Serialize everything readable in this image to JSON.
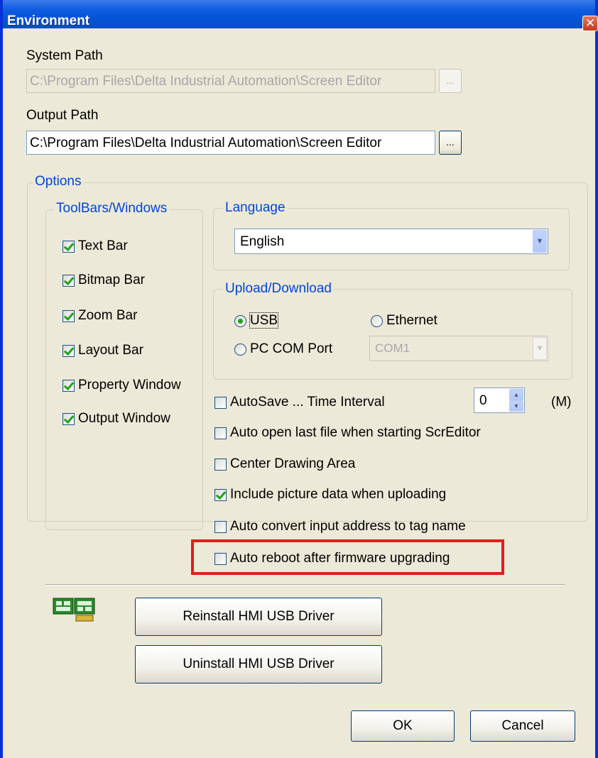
{
  "window": {
    "title": "Environment",
    "close_glyph": "✕"
  },
  "system_path": {
    "label": "System Path",
    "value": "C:\\Program Files\\Delta Industrial Automation\\Screen Editor",
    "browse_label": "..."
  },
  "output_path": {
    "label": "Output Path",
    "value": "C:\\Program Files\\Delta Industrial Automation\\Screen Editor",
    "browse_label": "..."
  },
  "options": {
    "title": "Options",
    "toolbars": {
      "title": "ToolBars/Windows",
      "items": [
        {
          "label": "Text Bar",
          "checked": true
        },
        {
          "label": "Bitmap Bar",
          "checked": true
        },
        {
          "label": "Zoom Bar",
          "checked": true
        },
        {
          "label": "Layout Bar",
          "checked": true
        },
        {
          "label": "Property Window",
          "checked": true
        },
        {
          "label": "Output Window",
          "checked": true
        }
      ]
    },
    "language": {
      "title": "Language",
      "selected": "English"
    },
    "upload": {
      "title": "Upload/Download",
      "usb": "USB",
      "ethernet": "Ethernet",
      "pc_com": "PC COM Port",
      "selected": "USB",
      "com_port": "COM1"
    },
    "autosave": {
      "label": "AutoSave ...  Time Interval",
      "value": "0",
      "unit": "(M)",
      "checked": false
    },
    "checks": [
      {
        "label": "Auto open last file when starting ScrEditor",
        "checked": false
      },
      {
        "label": "Center Drawing Area",
        "checked": false
      },
      {
        "label": "Include picture data when uploading",
        "checked": true
      },
      {
        "label": "Auto convert input address to tag name",
        "checked": false
      },
      {
        "label": "Auto reboot after firmware upgrading",
        "checked": false
      }
    ],
    "highlight_color": "#e31d1d"
  },
  "driver": {
    "icon": "usb-driver-icon",
    "reinstall": "Reinstall HMI USB Driver",
    "uninstall": "Uninstall HMI USB Driver"
  },
  "footer": {
    "ok": "OK",
    "cancel": "Cancel"
  }
}
